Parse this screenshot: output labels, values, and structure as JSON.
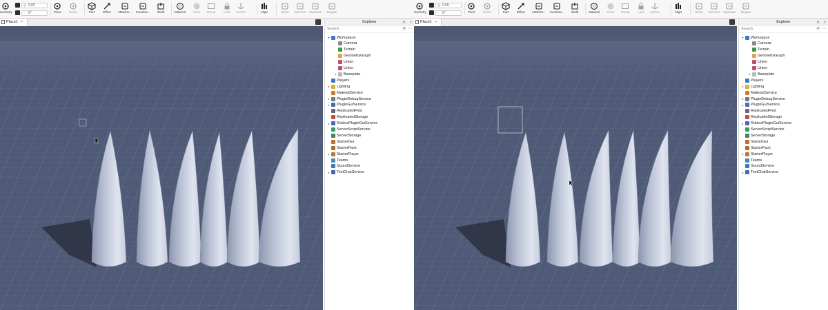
{
  "toolbar": {
    "geometry_label": "Geometry",
    "snap_move_value": "0.05",
    "snap_rotate_value": "5°",
    "tools": [
      {
        "label": "Pivot",
        "icon": "pivot-icon",
        "dim": false
      },
      {
        "label": "Reset",
        "icon": "reset-icon",
        "dim": true
      },
      {
        "label": "Part",
        "icon": "part-icon",
        "dim": false
      },
      {
        "label": "Effect",
        "icon": "effect-icon",
        "dim": false
      },
      {
        "label": "Attachm...",
        "icon": "attachment-icon",
        "dim": false
      },
      {
        "label": "Constrai...",
        "icon": "constraint-icon",
        "dim": false
      },
      {
        "label": "Weld",
        "icon": "weld-icon",
        "dim": false
      },
      {
        "label": "Material",
        "icon": "material-icon",
        "dim": false
      },
      {
        "label": "Color",
        "icon": "color-icon",
        "dim": true
      },
      {
        "label": "Group",
        "icon": "group-icon",
        "dim": true
      },
      {
        "label": "Lock",
        "icon": "lock-icon",
        "dim": true
      },
      {
        "label": "Anchor",
        "icon": "anchor-icon",
        "dim": true
      },
      {
        "label": "Align",
        "icon": "align-icon",
        "dim": false
      },
      {
        "label": "Union",
        "icon": "union-icon",
        "dim": true
      },
      {
        "label": "Intersect",
        "icon": "intersect-icon",
        "dim": true
      },
      {
        "label": "Separate",
        "icon": "separate-icon",
        "dim": true
      },
      {
        "label": "Negate",
        "icon": "negate-icon",
        "dim": true
      }
    ]
  },
  "tab": {
    "label": "Place1",
    "close": "×"
  },
  "explorer": {
    "title": "Explorer",
    "search_placeholder": "Search",
    "items": [
      {
        "label": "Workspace",
        "level": 0,
        "arrow": "▾",
        "icon": "workspace-icon",
        "color": "#3a78c9"
      },
      {
        "label": "Camera",
        "level": 1,
        "arrow": "",
        "icon": "camera-icon",
        "color": "#8a8a8a"
      },
      {
        "label": "Terrain",
        "level": 1,
        "arrow": "",
        "icon": "terrain-icon",
        "color": "#3c9a4a"
      },
      {
        "label": "GeometryGraph",
        "level": 1,
        "arrow": "",
        "icon": "folder-icon",
        "color": "#d9a84a"
      },
      {
        "label": "Union",
        "level": 1,
        "arrow": "",
        "icon": "union-icon",
        "color": "#c0506a"
      },
      {
        "label": "Union",
        "level": 1,
        "arrow": "",
        "icon": "union-icon",
        "color": "#c0506a"
      },
      {
        "label": "Baseplate",
        "level": 1,
        "arrow": "▸",
        "icon": "part-icon",
        "color": "#b9b9b9"
      },
      {
        "label": "Players",
        "level": 0,
        "arrow": "",
        "icon": "players-icon",
        "color": "#3c7ac0"
      },
      {
        "label": "Lighting",
        "level": 0,
        "arrow": "▸",
        "icon": "lighting-icon",
        "color": "#e0b02c"
      },
      {
        "label": "MaterialService",
        "level": 0,
        "arrow": "",
        "icon": "material-service-icon",
        "color": "#c87b3a"
      },
      {
        "label": "PluginDebugService",
        "level": 0,
        "arrow": "▸",
        "icon": "plugin-debug-icon",
        "color": "#777777"
      },
      {
        "label": "PluginGuiService",
        "level": 0,
        "arrow": "▸",
        "icon": "plugin-gui-icon",
        "color": "#4a6ab8"
      },
      {
        "label": "ReplicatedFirst",
        "level": 0,
        "arrow": "",
        "icon": "replicated-first-icon",
        "color": "#6a6a6a"
      },
      {
        "label": "ReplicatedStorage",
        "level": 0,
        "arrow": "",
        "icon": "replicated-storage-icon",
        "color": "#c84a4a"
      },
      {
        "label": "RobloxPluginGuiService",
        "level": 0,
        "arrow": "▸",
        "icon": "roblox-plugin-gui-icon",
        "color": "#4a6ab8"
      },
      {
        "label": "ServerScriptService",
        "level": 0,
        "arrow": "",
        "icon": "server-script-icon",
        "color": "#3a9a6a"
      },
      {
        "label": "ServerStorage",
        "level": 0,
        "arrow": "",
        "icon": "server-storage-icon",
        "color": "#3a8a5a"
      },
      {
        "label": "StarterGui",
        "level": 0,
        "arrow": "",
        "icon": "starter-gui-icon",
        "color": "#c07030"
      },
      {
        "label": "StarterPack",
        "level": 0,
        "arrow": "",
        "icon": "starter-pack-icon",
        "color": "#b06a30"
      },
      {
        "label": "StarterPlayer",
        "level": 0,
        "arrow": "▸",
        "icon": "starter-player-icon",
        "color": "#c07a30"
      },
      {
        "label": "Teams",
        "level": 0,
        "arrow": "",
        "icon": "teams-icon",
        "color": "#4a8ab8"
      },
      {
        "label": "SoundService",
        "level": 0,
        "arrow": "",
        "icon": "sound-icon",
        "color": "#3a78c9"
      },
      {
        "label": "TextChatService",
        "level": 0,
        "arrow": "▸",
        "icon": "text-chat-icon",
        "color": "#4a6ab8"
      }
    ]
  },
  "colors": {
    "ground": "#4f5a76",
    "sky": "#4c5671",
    "spike_light": "#dfe4ef",
    "spike_dark": "#8c96ae"
  }
}
